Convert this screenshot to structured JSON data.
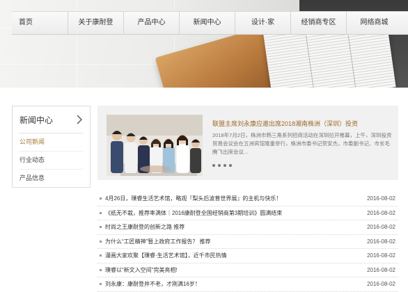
{
  "nav": {
    "items": [
      "首页",
      "关于康耐登",
      "产品中心",
      "新闻中心",
      "设计·家",
      "经销商专区",
      "网络商城"
    ]
  },
  "sidebar": {
    "title": "新闻中心",
    "chevron_icon": "chevron-right-icon",
    "items": [
      {
        "label": "公司新闻",
        "active": true
      },
      {
        "label": "行业动态",
        "active": false
      },
      {
        "label": "产品信息",
        "active": false
      }
    ]
  },
  "feature": {
    "title": "联盟主席刘永康应邀出席2018湘南株洲（深圳）投资",
    "summary": "2018年7月2日，株洲市韩三角系列招商活动在深圳拉开帷幕，上午，深圳投资贸易会议会在五洲宾馆隆重举行，株洲市委书记贺安杰，市委副书记、市长毛腾飞出席会议...",
    "carousel_dots": 4,
    "title_color": "#9a6a2a"
  },
  "news": [
    {
      "title": "4月26日，璞睿生活艺术馆，略观『梨头后波普世界展』的主机与快乐！",
      "date": "2016-08-02"
    },
    {
      "title": "《纸无不栽，推荐率满体｜2016康耐登全国经销商第3期培训》圆满结束",
      "date": "2016-08-02"
    },
    {
      "title": "时尚之王康耐登的创新之路    推荐",
      "date": "2016-08-02"
    },
    {
      "title": "为什么“工匠精神”暂上政府工作报告？    推荐",
      "date": "2016-08-02"
    },
    {
      "title": "漫画大家欢聚【璞睿·生活艺术馆】，近千市民热情",
      "date": "2016-08-02"
    },
    {
      "title": "璞睿以“新文入空间”完美亮相!",
      "date": "2016-08-02"
    },
    {
      "title": "刘永康：康耐登并不老，才刚满16岁！",
      "date": "2016-08-02"
    }
  ]
}
